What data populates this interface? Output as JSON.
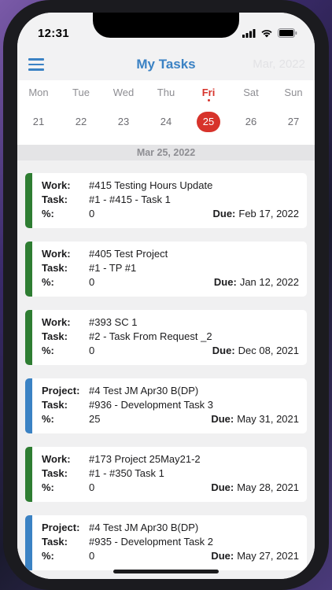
{
  "status_bar": {
    "time": "12:31"
  },
  "nav": {
    "title": "My Tasks",
    "month": "Mar, 2022"
  },
  "week": {
    "days": [
      {
        "name": "Mon",
        "num": "21"
      },
      {
        "name": "Tue",
        "num": "22"
      },
      {
        "name": "Wed",
        "num": "23"
      },
      {
        "name": "Thu",
        "num": "24"
      },
      {
        "name": "Fri",
        "num": "25"
      },
      {
        "name": "Sat",
        "num": "26"
      },
      {
        "name": "Sun",
        "num": "27"
      }
    ],
    "selected_index": 4
  },
  "date_header": "Mar 25, 2022",
  "colors": {
    "accent": "#3b82c4",
    "today": "#d7332b",
    "work_bar": "#2e7d32",
    "project_bar": "#3b82c4"
  },
  "tasks": [
    {
      "type": "work",
      "l1": "Work:",
      "v1": "#415 Testing Hours Update",
      "l2": "Task:",
      "v2": "#1 - #415 - Task 1",
      "l3": "%:",
      "v3": "0",
      "due_label": "Due:",
      "due": "Feb 17, 2022"
    },
    {
      "type": "work",
      "l1": "Work:",
      "v1": "#405 Test Project",
      "l2": "Task:",
      "v2": "#1 - TP #1",
      "l3": "%:",
      "v3": "0",
      "due_label": "Due:",
      "due": "Jan 12, 2022"
    },
    {
      "type": "work",
      "l1": "Work:",
      "v1": "#393 SC 1",
      "l2": "Task:",
      "v2": "#2 - Task From Request _2",
      "l3": "%:",
      "v3": "0",
      "due_label": "Due:",
      "due": "Dec 08, 2021"
    },
    {
      "type": "project",
      "l1": "Project:",
      "v1": "#4 Test JM Apr30 B(DP)",
      "l2": "Task:",
      "v2": "#936 - Development Task 3",
      "l3": "%:",
      "v3": "25",
      "due_label": "Due:",
      "due": "May 31, 2021"
    },
    {
      "type": "work",
      "l1": "Work:",
      "v1": "#173 Project 25May21-2",
      "l2": "Task:",
      "v2": "#1 - #350 Task 1",
      "l3": "%:",
      "v3": "0",
      "due_label": "Due:",
      "due": "May 28, 2021"
    },
    {
      "type": "project",
      "l1": "Project:",
      "v1": "#4 Test JM Apr30 B(DP)",
      "l2": "Task:",
      "v2": "#935 - Development Task 2",
      "l3": "%:",
      "v3": "0",
      "due_label": "Due:",
      "due": "May 27, 2021"
    }
  ]
}
